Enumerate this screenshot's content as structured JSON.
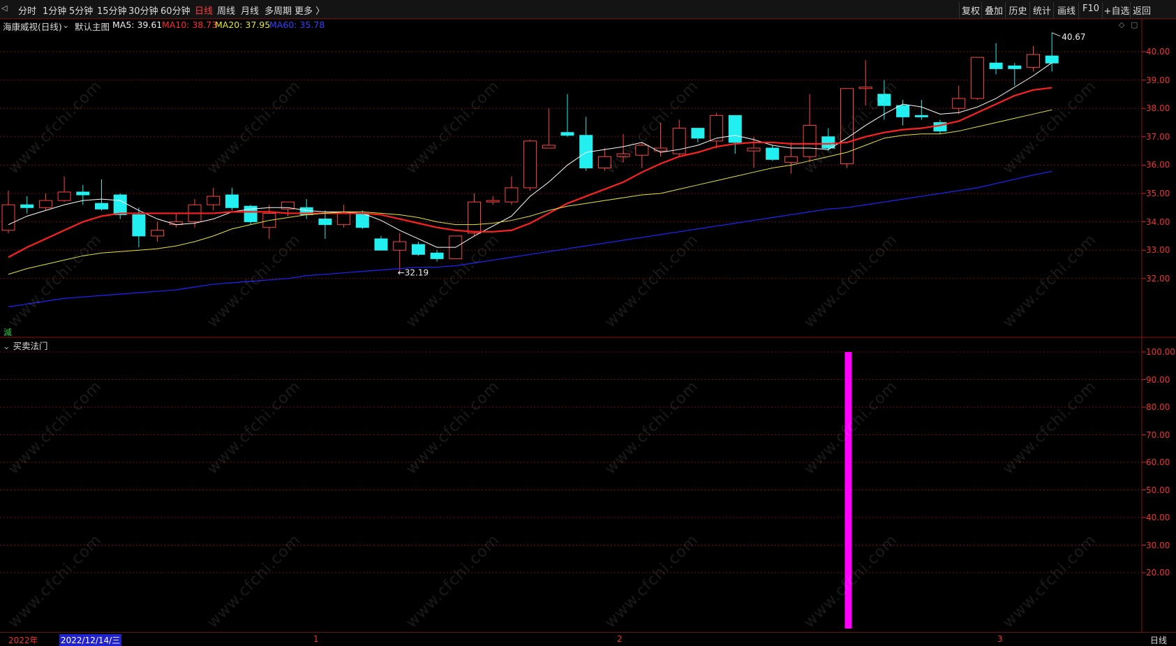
{
  "toolbar": {
    "back_glyph": "◁",
    "periods": [
      "分时",
      "1分钟",
      "5分钟",
      "15分钟",
      "30分钟",
      "60分钟",
      "日线",
      "周线",
      "月线",
      "多周期",
      "更多 〉"
    ],
    "active_period": "日线",
    "right_buttons": [
      "复权",
      "叠加",
      "历史",
      "统计",
      "画线",
      "F10",
      "+自选",
      "返回"
    ]
  },
  "main_chart": {
    "stock_name": "海康威视(日线)",
    "expand_icon": "chevron-down-icon",
    "template": "默认主图",
    "ma5": "MA5: 39.61",
    "ma10": "MA10: 38.73",
    "ma20": "MA20: 37.95",
    "ma60": "MA60: 35.78",
    "high_label": "40.67",
    "low_label": "32.19",
    "side_tag": "減",
    "price_ticks": [
      "40.00",
      "39.00",
      "38.00",
      "37.00",
      "36.00",
      "35.00",
      "34.00",
      "33.00",
      "32.00"
    ],
    "colors": {
      "ma5": "#ffffff",
      "ma10": "#ff2020",
      "ma20": "#e6e62e",
      "ma60": "#2222ff",
      "up": "#ff4444",
      "down": "#22f0f0"
    }
  },
  "sub_chart": {
    "title": "买卖法门",
    "ticks": [
      "100.00",
      "90.00",
      "80.00",
      "70.00",
      "60.00",
      "50.00",
      "40.00",
      "30.00",
      "20.00"
    ],
    "bar_color": "#ff00ff"
  },
  "date_axis": {
    "year_label": "2022年",
    "cursor_date": "2022/12/14/三",
    "month_labels": [
      "1",
      "2",
      "3"
    ],
    "period_label": "日线"
  },
  "watermark_text": "www.cfchi.com",
  "chart_data": [
    {
      "type": "candlestick",
      "title": "海康威视(日线)",
      "ylim": [
        30.5,
        41.5
      ],
      "candles": [
        {
          "o": 33.7,
          "h": 35.1,
          "l": 33.6,
          "c": 34.6
        },
        {
          "o": 34.6,
          "h": 34.9,
          "l": 34.3,
          "c": 34.5
        },
        {
          "o": 34.5,
          "h": 35.0,
          "l": 34.4,
          "c": 34.75
        },
        {
          "o": 34.75,
          "h": 35.6,
          "l": 34.7,
          "c": 35.05
        },
        {
          "o": 35.05,
          "h": 35.3,
          "l": 34.6,
          "c": 34.95
        },
        {
          "o": 34.65,
          "h": 35.5,
          "l": 34.4,
          "c": 34.45
        },
        {
          "o": 34.95,
          "h": 35.0,
          "l": 34.1,
          "c": 34.25
        },
        {
          "o": 34.25,
          "h": 34.5,
          "l": 33.1,
          "c": 33.5
        },
        {
          "o": 33.5,
          "h": 34.0,
          "l": 33.3,
          "c": 33.7
        },
        {
          "o": 33.9,
          "h": 34.3,
          "l": 33.8,
          "c": 34.0
        },
        {
          "o": 34.0,
          "h": 34.8,
          "l": 33.8,
          "c": 34.6
        },
        {
          "o": 34.6,
          "h": 35.2,
          "l": 34.4,
          "c": 34.9
        },
        {
          "o": 34.95,
          "h": 35.2,
          "l": 34.4,
          "c": 34.5
        },
        {
          "o": 34.55,
          "h": 34.6,
          "l": 33.9,
          "c": 34.0
        },
        {
          "o": 33.8,
          "h": 34.6,
          "l": 33.4,
          "c": 34.3
        },
        {
          "o": 34.45,
          "h": 34.7,
          "l": 34.2,
          "c": 34.7
        },
        {
          "o": 34.5,
          "h": 34.8,
          "l": 34.1,
          "c": 34.25
        },
        {
          "o": 34.1,
          "h": 34.4,
          "l": 33.4,
          "c": 33.9
        },
        {
          "o": 33.9,
          "h": 34.6,
          "l": 33.8,
          "c": 34.3
        },
        {
          "o": 34.3,
          "h": 34.4,
          "l": 33.75,
          "c": 33.8
        },
        {
          "o": 33.4,
          "h": 33.5,
          "l": 33.0,
          "c": 33.0
        },
        {
          "o": 33.0,
          "h": 33.6,
          "l": 32.2,
          "c": 33.3
        },
        {
          "o": 33.2,
          "h": 33.3,
          "l": 32.8,
          "c": 32.85
        },
        {
          "o": 32.9,
          "h": 33.0,
          "l": 32.6,
          "c": 32.7
        },
        {
          "o": 32.7,
          "h": 33.5,
          "l": 32.7,
          "c": 33.5
        },
        {
          "o": 33.6,
          "h": 35.0,
          "l": 33.5,
          "c": 34.7
        },
        {
          "o": 34.7,
          "h": 34.9,
          "l": 34.6,
          "c": 34.75
        },
        {
          "o": 34.7,
          "h": 35.6,
          "l": 34.6,
          "c": 35.2
        },
        {
          "o": 35.2,
          "h": 36.9,
          "l": 35.1,
          "c": 36.85
        },
        {
          "o": 36.6,
          "h": 38.0,
          "l": 36.6,
          "c": 36.7
        },
        {
          "o": 37.15,
          "h": 38.5,
          "l": 37.0,
          "c": 37.05
        },
        {
          "o": 37.05,
          "h": 37.7,
          "l": 35.8,
          "c": 35.9
        },
        {
          "o": 35.9,
          "h": 36.6,
          "l": 35.8,
          "c": 36.3
        },
        {
          "o": 36.3,
          "h": 37.1,
          "l": 36.1,
          "c": 36.4
        },
        {
          "o": 36.35,
          "h": 36.8,
          "l": 35.9,
          "c": 36.7
        },
        {
          "o": 36.5,
          "h": 37.5,
          "l": 36.3,
          "c": 36.6
        },
        {
          "o": 36.4,
          "h": 37.6,
          "l": 36.3,
          "c": 37.3
        },
        {
          "o": 37.3,
          "h": 37.3,
          "l": 36.8,
          "c": 36.95
        },
        {
          "o": 36.85,
          "h": 37.85,
          "l": 36.6,
          "c": 37.75
        },
        {
          "o": 37.75,
          "h": 37.75,
          "l": 36.4,
          "c": 36.8
        },
        {
          "o": 36.5,
          "h": 37.0,
          "l": 35.9,
          "c": 36.6
        },
        {
          "o": 36.6,
          "h": 36.7,
          "l": 36.15,
          "c": 36.2
        },
        {
          "o": 36.1,
          "h": 36.8,
          "l": 35.7,
          "c": 36.3
        },
        {
          "o": 36.3,
          "h": 38.5,
          "l": 36.1,
          "c": 37.4
        },
        {
          "o": 37.0,
          "h": 37.3,
          "l": 36.5,
          "c": 36.6
        },
        {
          "o": 36.05,
          "h": 38.7,
          "l": 35.9,
          "c": 38.7
        },
        {
          "o": 38.7,
          "h": 39.7,
          "l": 38.1,
          "c": 38.75
        },
        {
          "o": 38.5,
          "h": 39.0,
          "l": 37.6,
          "c": 38.1
        },
        {
          "o": 38.1,
          "h": 38.3,
          "l": 37.4,
          "c": 37.7
        },
        {
          "o": 37.75,
          "h": 38.3,
          "l": 37.6,
          "c": 37.7
        },
        {
          "o": 37.5,
          "h": 37.6,
          "l": 37.1,
          "c": 37.2
        },
        {
          "o": 38.0,
          "h": 38.8,
          "l": 37.8,
          "c": 38.35
        },
        {
          "o": 38.35,
          "h": 39.8,
          "l": 38.3,
          "c": 39.8
        },
        {
          "o": 39.6,
          "h": 40.3,
          "l": 39.2,
          "c": 39.4
        },
        {
          "o": 39.5,
          "h": 39.6,
          "l": 38.8,
          "c": 39.4
        },
        {
          "o": 39.45,
          "h": 40.2,
          "l": 39.3,
          "c": 39.9
        },
        {
          "o": 39.85,
          "h": 40.67,
          "l": 39.3,
          "c": 39.6
        }
      ],
      "ma_series": [
        {
          "name": "MA5",
          "values": [
            33.9,
            34.2,
            34.4,
            34.6,
            34.75,
            34.8,
            34.75,
            34.4,
            34.1,
            33.9,
            33.95,
            34.1,
            34.35,
            34.45,
            34.5,
            34.5,
            34.4,
            34.35,
            34.35,
            34.3,
            34.05,
            33.7,
            33.4,
            33.1,
            33.1,
            33.5,
            33.85,
            34.2,
            34.9,
            35.4,
            36.0,
            36.45,
            36.55,
            36.65,
            36.8,
            36.45,
            36.55,
            36.7,
            36.95,
            37.05,
            36.9,
            36.7,
            36.6,
            36.6,
            36.55,
            36.95,
            37.4,
            37.8,
            38.15,
            38.05,
            37.8,
            37.85,
            38.05,
            38.35,
            38.75,
            39.15,
            39.61
          ]
        },
        {
          "name": "MA10",
          "values": [
            32.75,
            33.1,
            33.4,
            33.7,
            34.0,
            34.2,
            34.3,
            34.3,
            34.3,
            34.3,
            34.3,
            34.3,
            34.35,
            34.35,
            34.35,
            34.3,
            34.3,
            34.3,
            34.3,
            34.3,
            34.25,
            34.1,
            33.95,
            33.8,
            33.7,
            33.65,
            33.65,
            33.7,
            33.95,
            34.3,
            34.65,
            34.9,
            35.15,
            35.4,
            35.75,
            36.05,
            36.3,
            36.45,
            36.65,
            36.75,
            36.8,
            36.8,
            36.75,
            36.75,
            36.75,
            36.8,
            37.0,
            37.15,
            37.25,
            37.3,
            37.4,
            37.55,
            37.85,
            38.15,
            38.45,
            38.65,
            38.73
          ]
        },
        {
          "name": "MA20",
          "values": [
            32.15,
            32.35,
            32.5,
            32.65,
            32.8,
            32.9,
            32.95,
            33.0,
            33.05,
            33.15,
            33.3,
            33.5,
            33.75,
            33.9,
            34.05,
            34.15,
            34.25,
            34.3,
            34.35,
            34.35,
            34.3,
            34.25,
            34.15,
            34.0,
            33.9,
            33.9,
            33.95,
            34.05,
            34.2,
            34.4,
            34.55,
            34.65,
            34.75,
            34.85,
            34.95,
            35.0,
            35.15,
            35.3,
            35.45,
            35.6,
            35.75,
            35.9,
            36.0,
            36.15,
            36.3,
            36.45,
            36.7,
            36.95,
            37.05,
            37.1,
            37.1,
            37.2,
            37.35,
            37.5,
            37.65,
            37.8,
            37.95
          ]
        },
        {
          "name": "MA60",
          "values": [
            31.0,
            31.1,
            31.2,
            31.3,
            31.35,
            31.4,
            31.45,
            31.5,
            31.55,
            31.6,
            31.7,
            31.8,
            31.85,
            31.9,
            31.95,
            32.0,
            32.1,
            32.15,
            32.2,
            32.25,
            32.3,
            32.35,
            32.4,
            32.4,
            32.45,
            32.55,
            32.65,
            32.75,
            32.85,
            32.95,
            33.05,
            33.15,
            33.25,
            33.35,
            33.45,
            33.55,
            33.65,
            33.75,
            33.85,
            33.95,
            34.05,
            34.15,
            34.25,
            34.35,
            34.45,
            34.5,
            34.6,
            34.7,
            34.8,
            34.9,
            35.0,
            35.1,
            35.2,
            35.35,
            35.5,
            35.65,
            35.78
          ]
        }
      ]
    },
    {
      "type": "bar",
      "title": "买卖法门",
      "ylim": [
        0,
        100
      ],
      "signal_bars": [
        {
          "index": 45,
          "value": 100
        }
      ]
    }
  ]
}
